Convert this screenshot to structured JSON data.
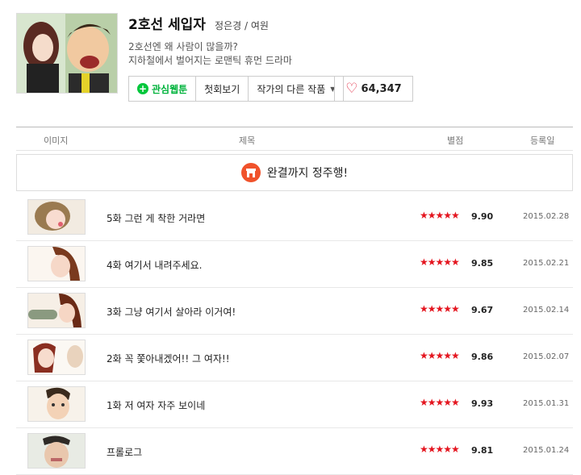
{
  "comic": {
    "title": "2호선 세입자",
    "author": "정은경 / 여원",
    "desc_line1": "2호선엔 왜 사람이 많을까?",
    "desc_line2": "지하철에서 벌어지는 로맨틱 휴먼 드라마"
  },
  "buttons": {
    "favorite": "관심웹툰",
    "first": "첫회보기",
    "other_works": "작가의 다른 작품",
    "likes": "64,347"
  },
  "table": {
    "col_image": "이미지",
    "col_title": "제목",
    "col_rating": "별점",
    "col_date": "등록일",
    "banner": "완결까지 정주행!"
  },
  "episodes": [
    {
      "title": "5화 그런 게 착한 거라면",
      "stars": "★★★★★",
      "score": "9.90",
      "date": "2015.02.28"
    },
    {
      "title": "4화 여기서 내려주세요.",
      "stars": "★★★★★",
      "score": "9.85",
      "date": "2015.02.21"
    },
    {
      "title": "3화 그냥 여기서 살아라 이거여!",
      "stars": "★★★★★",
      "score": "9.67",
      "date": "2015.02.14"
    },
    {
      "title": "2화 꼭 쫓아내겠어!! 그 여자!!",
      "stars": "★★★★★",
      "score": "9.86",
      "date": "2015.02.07"
    },
    {
      "title": "1화 저 여자 자주 보이네",
      "stars": "★★★★★",
      "score": "9.93",
      "date": "2015.01.31"
    },
    {
      "title": "프롤로그",
      "stars": "★★★★★",
      "score": "9.81",
      "date": "2015.01.24"
    }
  ]
}
